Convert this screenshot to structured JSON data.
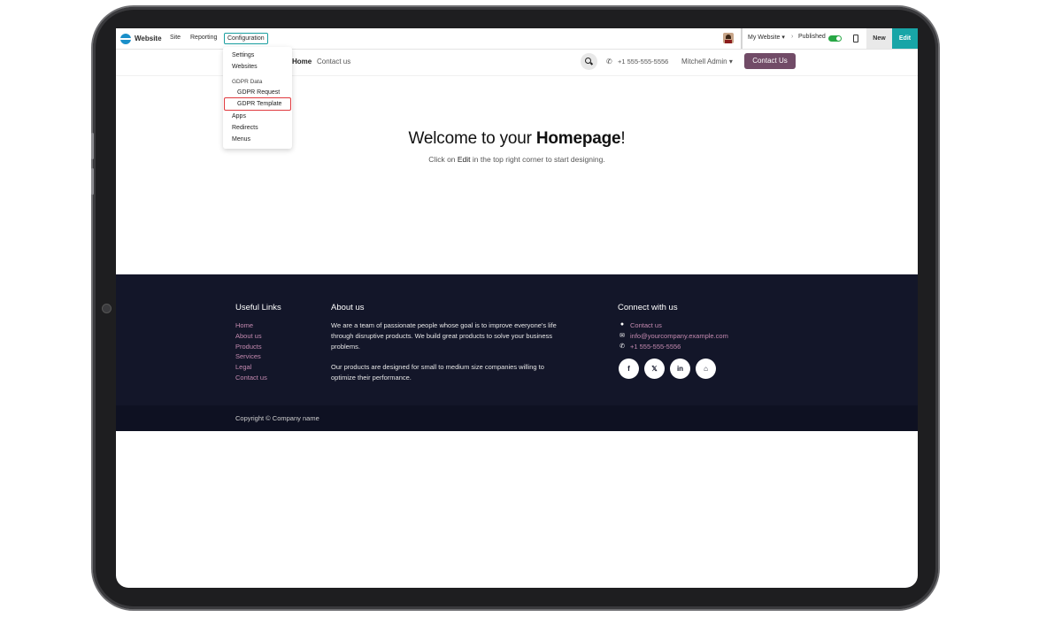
{
  "admin_bar": {
    "app_name": "Website",
    "menus": [
      "Site",
      "Reporting",
      "Configuration"
    ],
    "website_selector": "My Website",
    "published_label": "Published",
    "new_label": "New",
    "edit_label": "Edit",
    "colors": {
      "edit": "#18a5a7",
      "toggle": "#28a745"
    }
  },
  "config_dropdown": {
    "items": [
      "Settings",
      "Websites"
    ],
    "section_header": "GDPR Data",
    "sub_items": [
      "GDPR Request",
      "GDPR Template"
    ],
    "items_after": [
      "Apps",
      "Redirects",
      "Menus"
    ],
    "highlighted": "GDPR Template"
  },
  "site_header": {
    "nav": [
      "Home",
      "Contact us"
    ],
    "phone": "+1 555-555-5556",
    "user": "Mitchell Admin",
    "cta": "Contact Us",
    "cta_color": "#714b67"
  },
  "hero": {
    "title_prefix": "Welcome to your ",
    "title_bold": "Homepage",
    "title_suffix": "!",
    "subtitle_prefix": "Click on ",
    "subtitle_bold": "Edit",
    "subtitle_suffix": " in the top right corner to start designing."
  },
  "footer": {
    "useful_links_title": "Useful Links",
    "useful_links": [
      "Home",
      "About us",
      "Products",
      "Services",
      "Legal",
      "Contact us"
    ],
    "about_title": "About us",
    "about_p1": "We are a team of passionate people whose goal is to improve everyone's life through disruptive products. We build great products to solve your business problems.",
    "about_p2": "Our products are designed for small to medium size companies willing to optimize their performance.",
    "connect_title": "Connect with us",
    "connect_items": [
      "Contact us",
      "info@yourcompany.example.com",
      "+1 555-555-5556"
    ],
    "social_icons": [
      "f",
      "𝕏",
      "in",
      "⌂"
    ],
    "copyright": "Copyright © Company name",
    "colors": {
      "background": "#131629",
      "link": "#c48ab0"
    }
  }
}
